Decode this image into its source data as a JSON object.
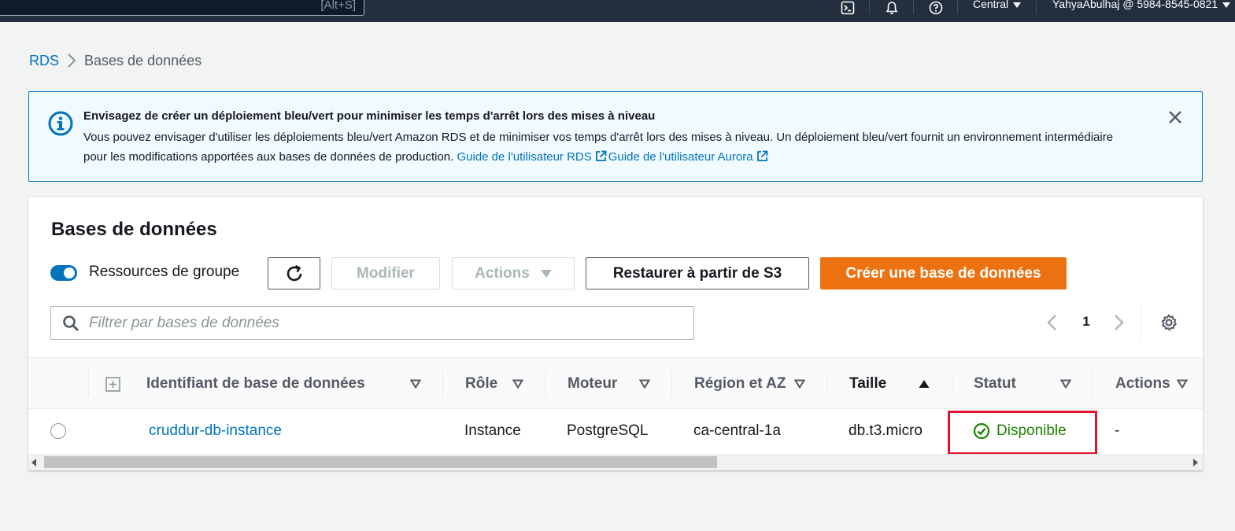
{
  "topnav": {
    "search_shortcut": "[Alt+S]",
    "region": "Central",
    "account": "YahyaAbulhaj @ 5984-8545-0821"
  },
  "breadcrumb": {
    "root": "RDS",
    "current": "Bases de données"
  },
  "flash": {
    "title": "Envisagez de créer un déploiement bleu/vert pour minimiser les temps d'arrêt lors des mises à niveau",
    "body": "Vous pouvez envisager d'utiliser les déploiements bleu/vert Amazon RDS et de minimiser vos temps d'arrêt lors des mises à niveau. Un déploiement bleu/vert fournit un environnement intermédiaire pour les modifications apportées aux bases de données de production.",
    "link_rds": "Guide de l'utilisateur RDS",
    "link_aurora": "Guide de l'utilisateur Aurora"
  },
  "panel": {
    "title": "Bases de données",
    "group_resources_label": "Ressources de groupe",
    "modify_label": "Modifier",
    "actions_label": "Actions",
    "restore_label": "Restaurer à partir de S3",
    "create_label": "Créer une base de données",
    "filter_placeholder": "Filtrer par bases de données",
    "page_number": "1"
  },
  "table": {
    "columns": {
      "identifier": "Identifiant de base de données",
      "role": "Rôle",
      "engine": "Moteur",
      "region": "Région et AZ",
      "size": "Taille",
      "status": "Statut",
      "actions": "Actions"
    },
    "rows": [
      {
        "identifier": "cruddur-db-instance",
        "role": "Instance",
        "engine": "PostgreSQL",
        "region": "ca-central-1a",
        "size": "db.t3.micro",
        "status": "Disponible",
        "actions": "-"
      }
    ]
  },
  "colors": {
    "topbar": "#232f3e",
    "link": "#0073bb",
    "primary_button": "#ec7211",
    "status_ok": "#1d8102",
    "highlight": "#e0152d"
  }
}
